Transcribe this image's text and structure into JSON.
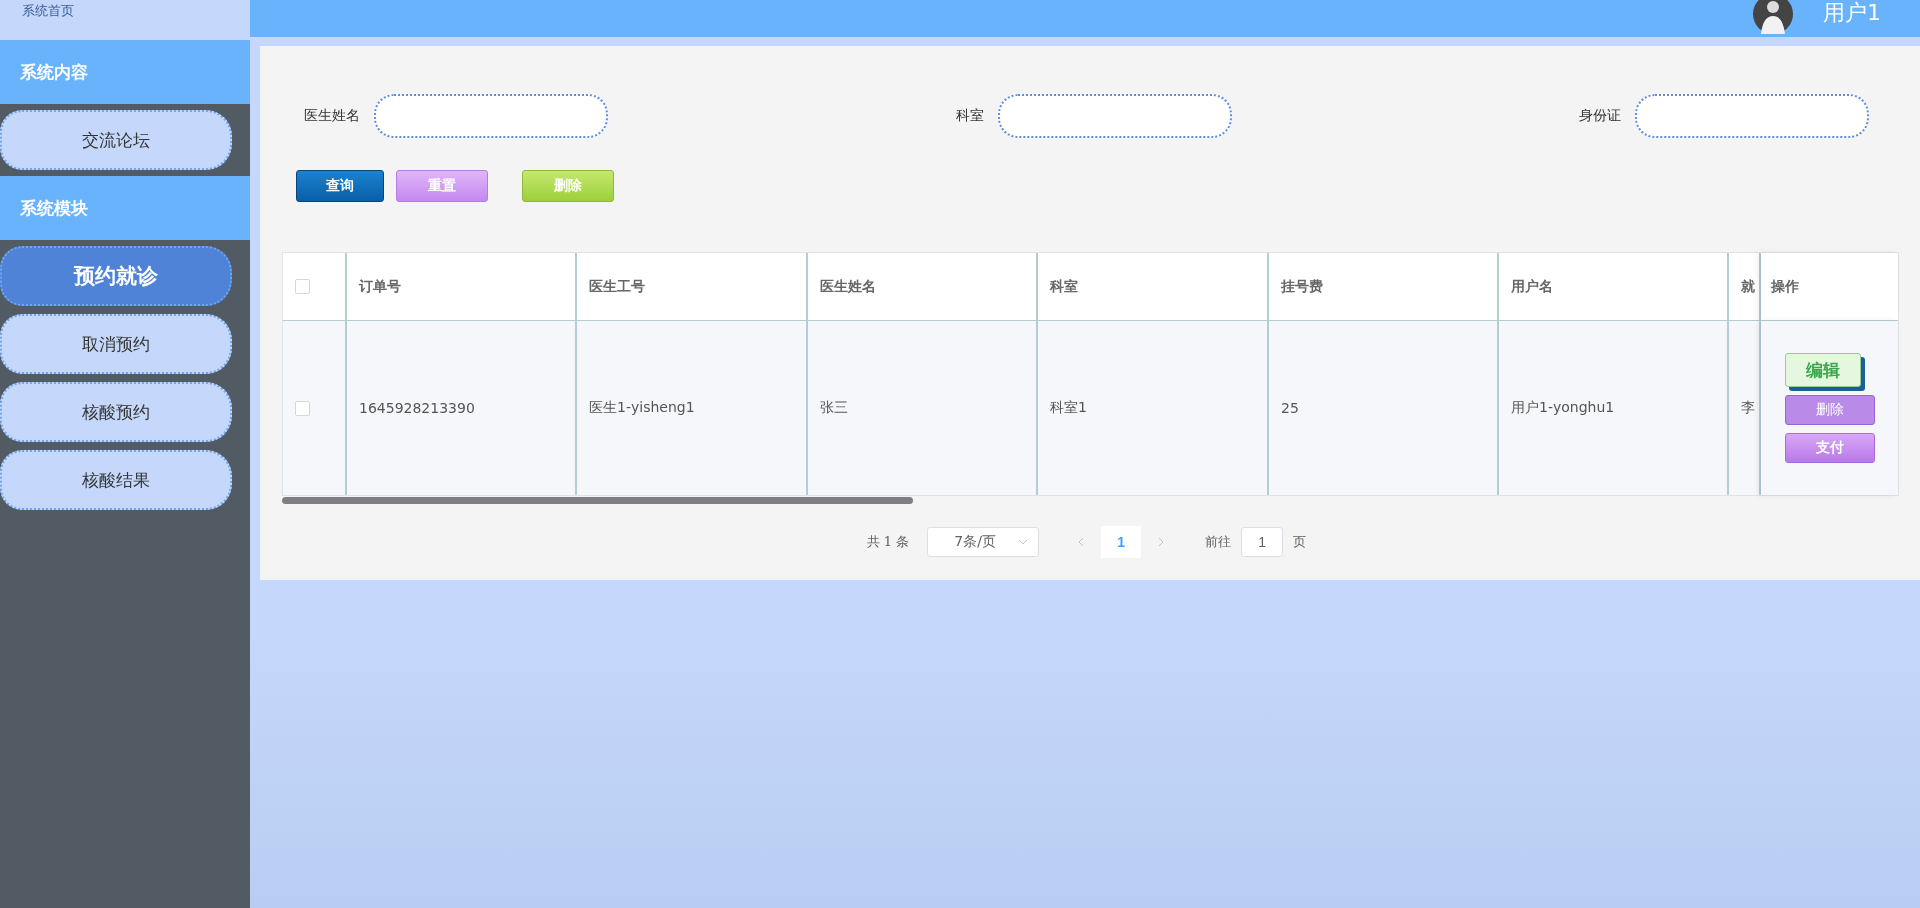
{
  "topbar": {
    "user": "用户1"
  },
  "sidebar": {
    "home": "系统首页",
    "sections": [
      {
        "title": "系统内容",
        "items": [
          {
            "label": "交流论坛",
            "selected": false
          }
        ]
      },
      {
        "title": "系统模块",
        "items": [
          {
            "label": "预约就诊",
            "selected": true
          },
          {
            "label": "取消预约",
            "selected": false
          },
          {
            "label": "核酸预约",
            "selected": false
          },
          {
            "label": "核酸结果",
            "selected": false
          }
        ]
      }
    ]
  },
  "search": {
    "fields": [
      {
        "label": "医生姓名"
      },
      {
        "label": "科室"
      },
      {
        "label": "身份证"
      }
    ],
    "buttons": [
      {
        "label": "查询",
        "kind": "query"
      },
      {
        "label": "重置",
        "kind": "reset"
      },
      {
        "label": "删除",
        "kind": "delete"
      }
    ]
  },
  "table": {
    "columns": [
      "订单号",
      "医生工号",
      "医生姓名",
      "科室",
      "挂号费",
      "用户名",
      "就"
    ],
    "actions_column": "操作",
    "all_checked": false,
    "rows": [
      {
        "checked": false,
        "cells": [
          "1645928213390",
          "医生1-yisheng1",
          "张三",
          "科室1",
          "25",
          "用户1-yonghu1",
          "李"
        ],
        "actions": [
          {
            "label": "编辑",
            "kind": "edit"
          },
          {
            "label": "删除",
            "kind": "delete"
          },
          {
            "label": "支付",
            "kind": "pay"
          }
        ]
      }
    ]
  },
  "pagination": {
    "total": "共 1 条",
    "page_size": "7条/页",
    "pages": [
      {
        "label": "1",
        "selected": true
      }
    ],
    "goto_label": "前往",
    "goto_value": "1",
    "page_suffix": "页"
  }
}
